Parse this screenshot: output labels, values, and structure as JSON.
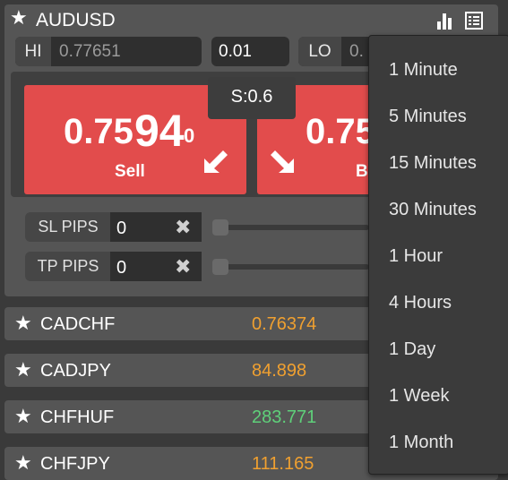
{
  "instrument": {
    "symbol": "AUDUSD",
    "hi_label": "HI",
    "hi_value": "0.77651",
    "lot_size": "0.01",
    "lo_label": "LO",
    "lo_value_partial": "0.",
    "spread": "S:0.6",
    "sell": {
      "price_main": "0.75",
      "price_big": "94",
      "price_small": "0",
      "label": "Sell"
    },
    "buy": {
      "price_main": "0.75",
      "label_partial": "B"
    },
    "sl": {
      "label": "SL PIPS",
      "value": "0"
    },
    "tp": {
      "label": "TP PIPS",
      "value": "0"
    }
  },
  "icons": {
    "favorite": "star-icon",
    "chart": "bar-chart-icon",
    "list": "list-icon",
    "clear": "close-icon",
    "sell_arrow": "arrow-down-left-icon",
    "buy_arrow": "arrow-down-right-icon"
  },
  "watchlist": [
    {
      "symbol": "CADCHF",
      "rate": "0.76374",
      "color": "#f0a030"
    },
    {
      "symbol": "CADJPY",
      "rate": "84.898",
      "color": "#f0a030"
    },
    {
      "symbol": "CHFHUF",
      "rate": "283.771",
      "color": "#5fd07a"
    },
    {
      "symbol": "CHFJPY",
      "rate": "111.165",
      "color": "#f0a030"
    }
  ],
  "timeframe_menu": [
    "1 Minute",
    "5 Minutes",
    "15 Minutes",
    "30 Minutes",
    "1 Hour",
    "4 Hours",
    "1 Day",
    "1 Week",
    "1 Month"
  ],
  "colors": {
    "sell_button": "#e24c4c",
    "panel": "#555555",
    "rate_up": "#5fd07a",
    "rate_neutral": "#f0a030"
  }
}
